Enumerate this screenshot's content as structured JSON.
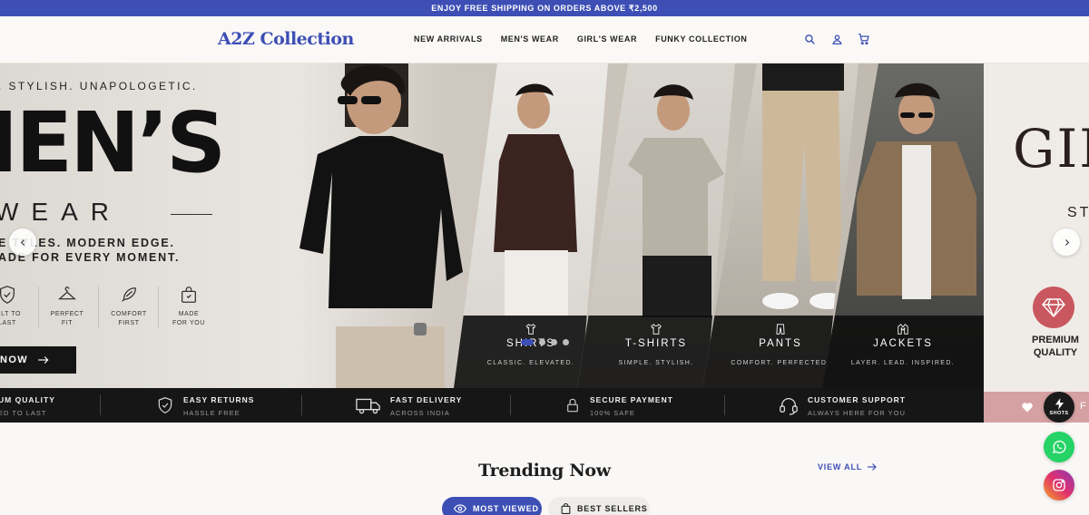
{
  "announcement": "ENJOY FREE SHIPPING ON ORDERS ABOVE ₹2,500",
  "brand": {
    "name": "A2Z Collection",
    "color": "#3d4fb5"
  },
  "nav": [
    "NEW ARRIVALS",
    "MEN'S WEAR",
    "GIRL'S WEAR",
    "FUNKY COLLECTION"
  ],
  "header_icons": [
    "search-icon",
    "account-icon",
    "cart-icon"
  ],
  "hero": {
    "tagline": ". STYLISH. UNAPOLOGETIC.",
    "title": "IEN’S",
    "subtitle_word": "WEAR",
    "sub_line1": "E TYLES. MODERN EDGE.",
    "sub_line2": "ADE FOR EVERY MOMENT.",
    "features": [
      {
        "icon": "shield-icon",
        "line1": "UILT TO",
        "line2": "LAST"
      },
      {
        "icon": "hanger-icon",
        "line1": "PERFECT",
        "line2": "FIT"
      },
      {
        "icon": "feather-icon",
        "line1": "COMFORT",
        "line2": "FIRST"
      },
      {
        "icon": "bag-icon",
        "line1": "MADE",
        "line2": "FOR YOU"
      }
    ],
    "shop_button": "NOW",
    "categories": [
      {
        "icon": "shirt-icon",
        "name": "SHIRTS",
        "sub": "CLASSIC. ELEVATED."
      },
      {
        "icon": "tshirt-icon",
        "name": "T-SHIRTS",
        "sub": "SIMPLE. STYLISH."
      },
      {
        "icon": "pants-icon",
        "name": "PANTS",
        "sub": "COMFORT. PERFECTED."
      },
      {
        "icon": "jacket-icon",
        "name": "JACKETS",
        "sub": "LAYER. LEAD. INSPIRED."
      }
    ],
    "trust": [
      {
        "icon": "",
        "title": "UM QUALITY",
        "sub": "ED TO LAST"
      },
      {
        "icon": "shield-check-icon",
        "title": "EASY RETURNS",
        "sub": "HASSLE FREE"
      },
      {
        "icon": "truck-icon",
        "title": "FAST DELIVERY",
        "sub": "ACROSS INDIA"
      },
      {
        "icon": "lock-icon",
        "title": "SECURE PAYMENT",
        "sub": "100% SAFE"
      },
      {
        "icon": "headset-icon",
        "title": "CUSTOMER SUPPORT",
        "sub": "ALWAYS HERE FOR YOU"
      }
    ],
    "dots": {
      "count": 4,
      "active": 0
    },
    "next_slide": {
      "title": "GIR",
      "subtitle": "ST",
      "badge_line1": "PREMIUM",
      "badge_line2": "QUALITY",
      "bar_text": "F"
    }
  },
  "floating": {
    "shots_label": "SHOTS"
  },
  "trending": {
    "title": "Trending Now",
    "view_all": "VIEW ALL",
    "tabs": [
      "MOST VIEWED",
      "BEST SELLERS"
    ],
    "active_tab": 0
  }
}
